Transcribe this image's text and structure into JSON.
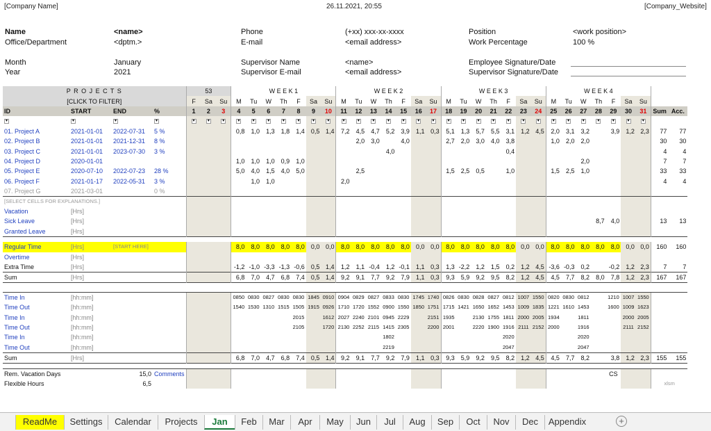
{
  "header": {
    "company": "[Company Name]",
    "datetime": "26.11.2021, 20:55",
    "website": "[Company_Website]"
  },
  "info": {
    "name_lbl": "Name",
    "name_val": "<name>",
    "office_lbl": "Office/Department",
    "office_val": "<dptm.>",
    "month_lbl": "Month",
    "month_val": "January",
    "year_lbl": "Year",
    "year_val": "2021",
    "phone_lbl": "Phone",
    "phone_val": "(+xx) xxx-xx-xxxx",
    "email_lbl": "E-mail",
    "email_val": "<email address>",
    "sup_name_lbl": "Supervisor Name",
    "sup_name_val": "<name>",
    "sup_email_lbl": "Supervisor E-mail",
    "sup_email_val": "<email address>",
    "position_lbl": "Position",
    "position_val": "<work position>",
    "workpct_lbl": "Work Percentage",
    "workpct_val": "100 %",
    "emp_sig_lbl": "Employee Signature/Date",
    "sup_sig_lbl": "Supervisor Signature/Date"
  },
  "grid": {
    "projects_title": "P R O J E C T S",
    "filter_hint": "[CLICK TO FILTER]",
    "week53": "53",
    "weeks": [
      {
        "label": "W    E    E    K    1"
      },
      {
        "label": "W    E    E    K    2"
      },
      {
        "label": "W    E    E    K    3"
      },
      {
        "label": "W    E    E    K    4"
      }
    ],
    "dows": [
      "F",
      "Sa",
      "Su",
      "M",
      "Tu",
      "W",
      "Th",
      "F",
      "Sa",
      "Su",
      "M",
      "Tu",
      "W",
      "Th",
      "F",
      "Sa",
      "Su",
      "M",
      "Tu",
      "W",
      "Th",
      "F",
      "Sa",
      "Su",
      "M",
      "Tu",
      "W",
      "Th",
      "F",
      "Sa",
      "Su"
    ],
    "days": [
      "1",
      "2",
      "3",
      "4",
      "5",
      "6",
      "7",
      "8",
      "9",
      "10",
      "11",
      "12",
      "13",
      "14",
      "15",
      "16",
      "17",
      "18",
      "19",
      "20",
      "21",
      "22",
      "23",
      "24",
      "25",
      "26",
      "27",
      "28",
      "29",
      "30",
      "31"
    ],
    "col_id": "ID",
    "col_start": "START",
    "col_end": "END",
    "col_pct": "%",
    "col_sum": "Sum",
    "col_acc": "Acc.",
    "projects": [
      {
        "id": "01. Project A",
        "start": "2021-01-01",
        "end": "2022-07-31",
        "pct": "5 %",
        "days": [
          "",
          "",
          "",
          "0,8",
          "1,0",
          "1,3",
          "1,8",
          "1,4",
          "0,5",
          "1,4",
          "7,2",
          "4,5",
          "4,7",
          "5,2",
          "3,9",
          "1,1",
          "0,3",
          "5,1",
          "1,3",
          "5,7",
          "5,5",
          "3,1",
          "1,2",
          "4,5",
          "2,0",
          "3,1",
          "3,2",
          "",
          "3,9",
          "1,2",
          "2,3"
        ],
        "sum": "77",
        "acc": "77"
      },
      {
        "id": "02. Project B",
        "start": "2021-01-01",
        "end": "2021-12-31",
        "pct": "8 %",
        "days": [
          "",
          "",
          "",
          "",
          "",
          "",
          "",
          "",
          "",
          "",
          "",
          "2,0",
          "3,0",
          "",
          "4,0",
          "",
          "",
          "2,7",
          "2,0",
          "3,0",
          "4,0",
          "3,8",
          "",
          "",
          "1,0",
          "2,0",
          "2,0",
          "",
          "",
          "",
          ""
        ],
        "sum": "30",
        "acc": "30"
      },
      {
        "id": "03. Project C",
        "start": "2021-01-01",
        "end": "2023-07-30",
        "pct": "3 %",
        "days": [
          "",
          "",
          "",
          "",
          "",
          "",
          "",
          "",
          "",
          "",
          "",
          "",
          "",
          "4,0",
          "",
          "",
          "",
          "",
          "",
          "",
          "",
          "0,4",
          "",
          "",
          "",
          "",
          "",
          "",
          "",
          "",
          ""
        ],
        "sum": "4",
        "acc": "4"
      },
      {
        "id": "04. Project D",
        "start": "2020-01-01",
        "end": "",
        "pct": "",
        "days": [
          "",
          "",
          "",
          "1,0",
          "1,0",
          "1,0",
          "0,9",
          "1,0",
          "",
          "",
          "",
          "",
          "",
          "",
          "",
          "",
          "",
          "",
          "",
          "",
          "",
          "",
          "",
          "",
          "",
          "",
          "2,0",
          "",
          "",
          "",
          ""
        ],
        "sum": "7",
        "acc": "7"
      },
      {
        "id": "05. Project E",
        "start": "2020-07-10",
        "end": "2022-07-23",
        "pct": "28 %",
        "days": [
          "",
          "",
          "",
          "5,0",
          "4,0",
          "1,5",
          "4,0",
          "5,0",
          "",
          "",
          "",
          "2,5",
          "",
          "",
          "",
          "",
          "",
          "1,5",
          "2,5",
          "0,5",
          "",
          "1,0",
          "",
          "",
          "1,5",
          "2,5",
          "1,0",
          "",
          "",
          "",
          ""
        ],
        "sum": "33",
        "acc": "33"
      },
      {
        "id": "06. Project F",
        "start": "2021-01-17",
        "end": "2022-05-31",
        "pct": "3 %",
        "days": [
          "",
          "",
          "",
          "",
          "1,0",
          "1,0",
          "",
          "",
          "",
          "",
          "2,0",
          "",
          "",
          "",
          "",
          "",
          "",
          "",
          "",
          "",
          "",
          "",
          "",
          "",
          "",
          "",
          "",
          "",
          "",
          "",
          ""
        ],
        "sum": "4",
        "acc": "4"
      },
      {
        "id": "07. Project G",
        "start": "2021-03-01",
        "end": "",
        "pct": "0 %",
        "days": [
          "",
          "",
          "",
          "",
          "",
          "",
          "",
          "",
          "",
          "",
          "",
          "",
          "",
          "",
          "",
          "",
          "",
          "",
          "",
          "",
          "",
          "",
          "",
          "",
          "",
          "",
          "",
          "",
          "",
          "",
          ""
        ],
        "sum": "",
        "acc": ""
      }
    ],
    "select_hint": "[SELECT CELLS FOR EXPLANATIONS.]",
    "hrs": "[Hrs]",
    "hhmm": "[hh:mm]",
    "vacation": "Vacation",
    "sick": "Sick Leave",
    "granted": "Granted Leave",
    "sick_days": [
      "",
      "",
      "",
      "",
      "",
      "",
      "",
      "",
      "",
      "",
      "",
      "",
      "",
      "",
      "",
      "",
      "",
      "",
      "",
      "",
      "",
      "",
      "",
      "",
      "",
      "",
      "",
      "8,7",
      "4,0",
      "",
      ""
    ],
    "sick_sum": "13",
    "sick_acc": "13",
    "regular": "Regular Time",
    "start_here": "[START HERE]",
    "regular_days": [
      "",
      "",
      "",
      "8,0",
      "8,0",
      "8,0",
      "8,0",
      "8,0",
      "0,0",
      "0,0",
      "8,0",
      "8,0",
      "8,0",
      "8,0",
      "8,0",
      "0,0",
      "0,0",
      "8,0",
      "8,0",
      "8,0",
      "8,0",
      "8,0",
      "0,0",
      "0,0",
      "8,0",
      "8,0",
      "8,0",
      "8,0",
      "8,0",
      "0,0",
      "0,0"
    ],
    "regular_sum": "160",
    "regular_acc": "160",
    "overtime": "Overtime",
    "extra": "Extra Time",
    "extra_days": [
      "",
      "",
      "",
      "-1,2",
      "-1,0",
      "-3,3",
      "-1,3",
      "-0,6",
      "0,5",
      "1,4",
      "1,2",
      "1,1",
      "-0,4",
      "1,2",
      "-0,1",
      "1,1",
      "0,3",
      "1,3",
      "-2,2",
      "1,2",
      "1,5",
      "0,2",
      "1,2",
      "4,5",
      "-3,6",
      "-0,3",
      "0,2",
      "",
      "-0,2",
      "1,2",
      "2,3"
    ],
    "extra_sum": "7",
    "extra_acc": "7",
    "sum_lbl": "Sum",
    "sum_days": [
      "",
      "",
      "",
      "6,8",
      "7,0",
      "4,7",
      "6,8",
      "7,4",
      "0,5",
      "1,4",
      "9,2",
      "9,1",
      "7,7",
      "9,2",
      "7,9",
      "1,1",
      "0,3",
      "9,3",
      "5,9",
      "9,2",
      "9,5",
      "8,2",
      "1,2",
      "4,5",
      "4,5",
      "7,7",
      "8,2",
      "8,0",
      "7,8",
      "1,2",
      "2,3"
    ],
    "sum_sum": "167",
    "sum_acc": "167",
    "time_in": "Time In",
    "time_out": "Time Out",
    "times": [
      {
        "lbl": "Time In",
        "d": [
          "",
          "",
          "",
          "0850",
          "0830",
          "0827",
          "0830",
          "0830",
          "1845",
          "0910",
          "0904",
          "0829",
          "0827",
          "0833",
          "0830",
          "1745",
          "1740",
          "0826",
          "0830",
          "0828",
          "0827",
          "0812",
          "1007",
          "1550",
          "0820",
          "0830",
          "0812",
          "",
          "1210",
          "1007",
          "1550"
        ]
      },
      {
        "lbl": "Time Out",
        "d": [
          "",
          "",
          "",
          "1540",
          "1530",
          "1310",
          "1515",
          "1505",
          "1915",
          "0926",
          "1710",
          "1720",
          "1552",
          "0900",
          "1550",
          "1850",
          "1751",
          "1715",
          "1421",
          "1650",
          "1652",
          "1453",
          "1009",
          "1835",
          "1221",
          "1610",
          "1453",
          "",
          "1600",
          "1009",
          "1623"
        ]
      },
      {
        "lbl": "Time In",
        "d": [
          "",
          "",
          "",
          "",
          "",
          "",
          "",
          "2015",
          "",
          "1612",
          "2027",
          "2240",
          "2101",
          "0945",
          "2229",
          "",
          "2151",
          "1935",
          "",
          "2130",
          "1755",
          "1811",
          "2000",
          "2005",
          "1934",
          "",
          "1811",
          "",
          "",
          "2000",
          "2005"
        ]
      },
      {
        "lbl": "Time Out",
        "d": [
          "",
          "",
          "",
          "",
          "",
          "",
          "",
          "2105",
          "",
          "1720",
          "2130",
          "2252",
          "2115",
          "1415",
          "2305",
          "",
          "2200",
          "2001",
          "",
          "2220",
          "1900",
          "1916",
          "2111",
          "2152",
          "2000",
          "",
          "1916",
          "",
          "",
          "2111",
          "2152"
        ]
      },
      {
        "lbl": "Time In",
        "d": [
          "",
          "",
          "",
          "",
          "",
          "",
          "",
          "",
          "",
          "",
          "",
          "",
          "",
          "1802",
          "",
          "",
          "",
          "",
          "",
          "",
          "",
          "2020",
          "",
          "",
          "",
          "",
          "2020",
          "",
          "",
          "",
          ""
        ]
      },
      {
        "lbl": "Time Out",
        "d": [
          "",
          "",
          "",
          "",
          "",
          "",
          "",
          "",
          "",
          "",
          "",
          "",
          "",
          "2219",
          "",
          "",
          "",
          "",
          "",
          "",
          "",
          "2047",
          "",
          "",
          "",
          "",
          "2047",
          "",
          "",
          "",
          ""
        ]
      }
    ],
    "sum2_days": [
      "",
      "",
      "",
      "6,8",
      "7,0",
      "4,7",
      "6,8",
      "7,4",
      "0,5",
      "1,4",
      "9,2",
      "9,1",
      "7,7",
      "9,2",
      "7,9",
      "1,1",
      "0,3",
      "9,3",
      "5,9",
      "9,2",
      "9,5",
      "8,2",
      "1,2",
      "4,5",
      "4,5",
      "7,7",
      "8,2",
      "",
      "3,8",
      "1,2",
      "2,3"
    ],
    "sum2_sum": "155",
    "sum2_acc": "155",
    "rem_vac": "Rem. Vacation Days",
    "rem_vac_val": "15,0",
    "comments": "Comments",
    "flex": "Flexible Hours",
    "flex_val": "6,5",
    "cs": "CS",
    "xlsm": "xlsm"
  },
  "tabs": [
    "ReadMe",
    "Settings",
    "Calendar",
    "Projects",
    "Jan",
    "Feb",
    "Mar",
    "Apr",
    "May",
    "Jun",
    "Jul",
    "Aug",
    "Sep",
    "Oct",
    "Nov",
    "Dec",
    "Appendix"
  ],
  "colors": {
    "highlight": "#ffff00",
    "project_blue": "#1f3fbf",
    "weekend": "#eae7dd",
    "active_tab": "#1a7a3a"
  }
}
